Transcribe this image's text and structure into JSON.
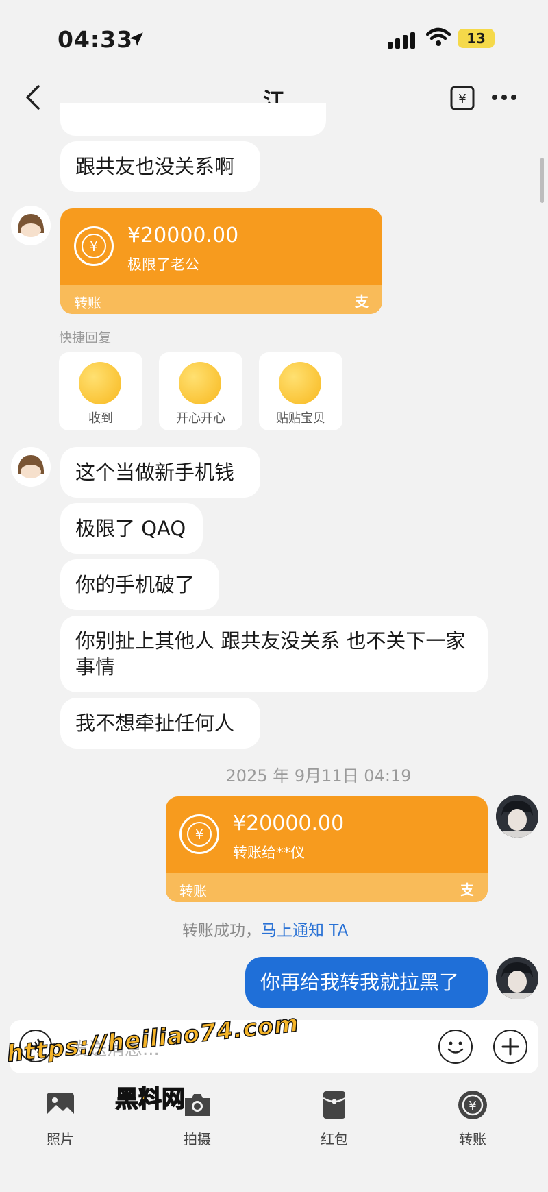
{
  "status_bar": {
    "time": "04:33",
    "battery": "13"
  },
  "header": {
    "title": "江"
  },
  "messages": {
    "m1": "跟共友也没关系啊",
    "transfer_in": {
      "amount": "¥20000.00",
      "memo": "极限了老公",
      "label": "转账",
      "brand_glyph": "支"
    },
    "quick_reply": {
      "title": "快捷回复",
      "items": [
        {
          "label": "收到"
        },
        {
          "label": "开心开心"
        },
        {
          "label": "贴贴宝贝"
        }
      ]
    },
    "m2": "这个当做新手机钱",
    "m3": "极限了 QAQ",
    "m4": "你的手机破了",
    "m5": "你别扯上其他人 跟共友没关系 也不关下一家事情",
    "m6": "我不想牵扯任何人",
    "timestamp": "2025 年 9月11日 04:19",
    "transfer_out": {
      "amount": "¥20000.00",
      "memo": "转账给**仪",
      "label": "转账",
      "brand_glyph": "支"
    },
    "transfer_status": {
      "text": "转账成功，",
      "link": "马上通知 TA"
    },
    "m7": "你再给我转我就拉黑了"
  },
  "composer": {
    "placeholder": "发送消息..."
  },
  "watermark": {
    "url": "https://heiliao74.com",
    "cn": "黑料网"
  },
  "toolbar": [
    {
      "label": "照片",
      "icon": "photo-icon"
    },
    {
      "label": "拍摄",
      "icon": "camera-icon"
    },
    {
      "label": "红包",
      "icon": "red-packet-icon"
    },
    {
      "label": "转账",
      "icon": "transfer-icon"
    }
  ],
  "colors": {
    "transfer_orange": "#f79b1e",
    "own_bubble_blue": "#1f6fd8",
    "link_blue": "#2a72d5"
  }
}
